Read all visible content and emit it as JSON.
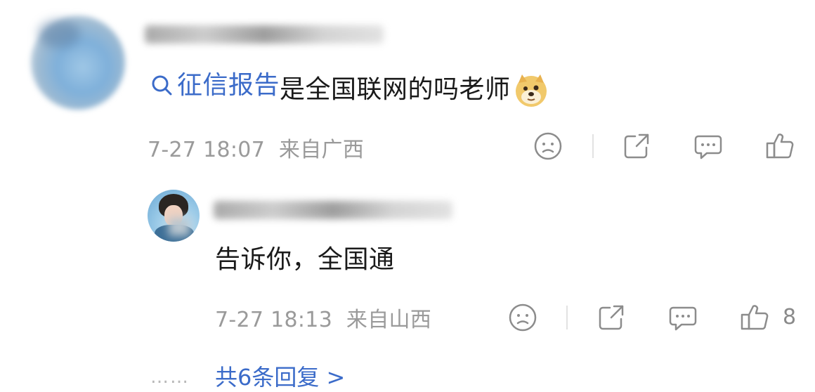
{
  "comment": {
    "search_keyword": "征信报告",
    "text_rest": "是全国联网的吗老师",
    "timestamp": "7-27 18:07",
    "location": "来自广西"
  },
  "reply": {
    "text": "告诉你，全国通",
    "timestamp": "7-27 18:13",
    "location": "来自山西",
    "like_count": "8"
  },
  "footer": {
    "replies_link": "共6条回复 >",
    "dots": "……"
  },
  "colors": {
    "link_blue": "#3b6bc9",
    "meta_gray": "#9a9a9a",
    "icon_gray": "#8c8c8c"
  }
}
